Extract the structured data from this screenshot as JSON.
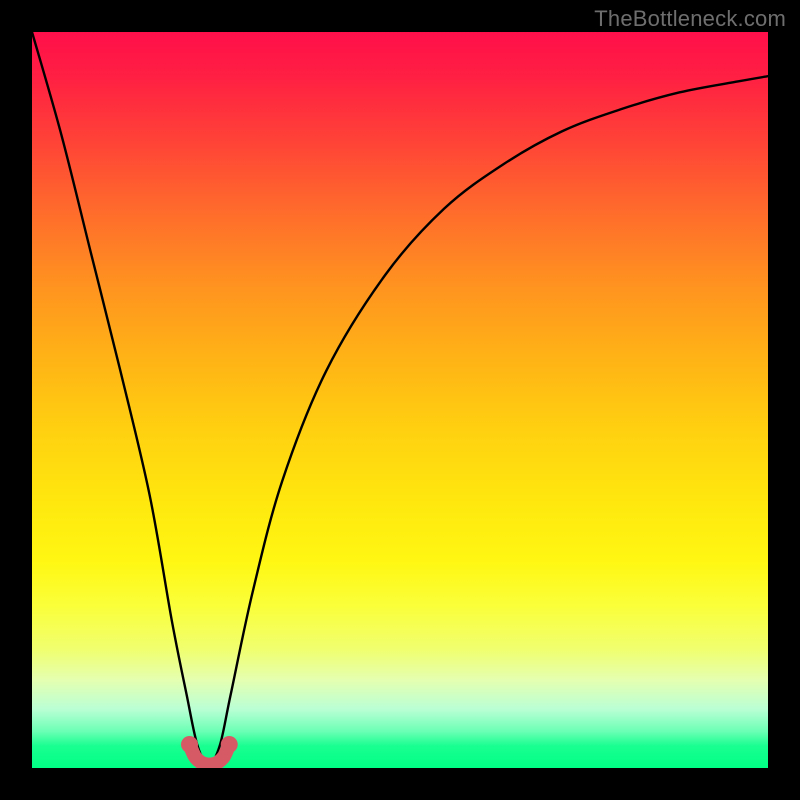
{
  "watermark": "TheBottleneck.com",
  "chart_data": {
    "type": "line",
    "title": "",
    "xlabel": "",
    "ylabel": "",
    "xlim": [
      0,
      100
    ],
    "ylim": [
      0,
      100
    ],
    "series": [
      {
        "name": "bottleneck-curve",
        "x": [
          0,
          4,
          8,
          12,
          16,
          19,
          21,
          22.5,
          24,
          25.5,
          27,
          30,
          34,
          40,
          48,
          56,
          64,
          72,
          80,
          88,
          96,
          100
        ],
        "values": [
          100,
          86,
          70,
          54,
          37,
          20,
          10,
          3,
          0.5,
          3,
          10,
          24,
          39,
          54,
          67,
          76,
          82,
          86.5,
          89.5,
          91.8,
          93.3,
          94
        ]
      }
    ],
    "highlight": {
      "name": "minimum-marker",
      "color": "#d65a66",
      "points_x": [
        21.4,
        22.1,
        22.9,
        23.7,
        24.5,
        25.3,
        26.1,
        26.8
      ],
      "points_y": [
        3.2,
        1.6,
        0.8,
        0.5,
        0.5,
        0.8,
        1.6,
        3.2
      ]
    }
  }
}
